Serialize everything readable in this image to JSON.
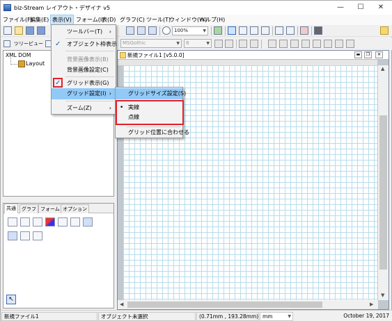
{
  "window": {
    "title": "biz-Stream レイアウト・デザイナ v5",
    "controls": {
      "minimize": "—",
      "maximize": "☐",
      "close": "✕"
    }
  },
  "menubar": [
    {
      "label": "ファイル(F)"
    },
    {
      "label": "編集(E)"
    },
    {
      "label": "表示(V)",
      "active": true
    },
    {
      "label": "フォーム(I)"
    },
    {
      "label": "表(D)"
    },
    {
      "label": "グラフ(C)"
    },
    {
      "label": "ツール(T)"
    },
    {
      "label": "ウィンドウ(W)"
    },
    {
      "label": "ヘルプ(H)"
    }
  ],
  "toolbar": {
    "zoom_value": "100%",
    "font_name": "MSGothic",
    "font_size": "8"
  },
  "left_pane": {
    "tab_tree": "ツリービュー",
    "tree_root": "XML DOM",
    "tree_child": "Layout"
  },
  "props": {
    "tabs": [
      "共通",
      "グラフ",
      "フォーム",
      "オプション"
    ]
  },
  "document": {
    "title": "新規ファイル1 [v5.0.0]"
  },
  "view_menu": {
    "items": [
      {
        "label": "ツールバー(T)",
        "arrow": "›"
      },
      {
        "label": "オブジェクト枠表示",
        "checked": true
      },
      {
        "label": "背景画像表示(B)",
        "disabled": true
      },
      {
        "label": "背景画像設定(C)"
      },
      {
        "label": "グリッド表示(G)",
        "checked": true
      },
      {
        "label": "グリッド設定(I)",
        "arrow": "›",
        "highlighted": true
      },
      {
        "label": "ズーム(Z)",
        "arrow": "›"
      }
    ]
  },
  "grid_menu": {
    "items": [
      {
        "label": "グリッドサイズ設定(S)",
        "highlighted": true
      },
      {
        "label": "実線",
        "selected": true
      },
      {
        "label": "点線"
      },
      {
        "label": "グリッド位置に合わせる"
      }
    ]
  },
  "status_bar": {
    "file": "新規ファイル1",
    "selection": "オブジェクト未選択",
    "coords": "(0.71mm , 193.28mm)",
    "unit": "mm",
    "date": "October 19, 2017"
  },
  "colors": {
    "grid_line": "#b7dceb",
    "menu_highlight": "#91c9f7",
    "callout_red": "#e0202a"
  }
}
